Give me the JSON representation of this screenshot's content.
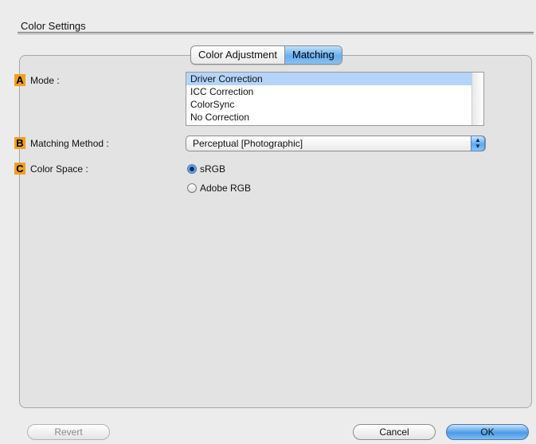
{
  "section_title": "Color Settings",
  "tabs": [
    {
      "label": "Color Adjustment",
      "active": false
    },
    {
      "label": "Matching",
      "active": true
    }
  ],
  "fields": {
    "mode": {
      "badge": "A",
      "label": "Mode :"
    },
    "matching_method": {
      "badge": "B",
      "label": "Matching Method :"
    },
    "color_space": {
      "badge": "C",
      "label": "Color Space :"
    }
  },
  "mode_list": {
    "items": [
      "Driver Correction",
      "ICC Correction",
      "ColorSync",
      "No Correction"
    ],
    "selected": "Driver Correction"
  },
  "matching_method_select": {
    "value": "Perceptual [Photographic]"
  },
  "color_space_options": [
    {
      "label": "sRGB",
      "checked": true
    },
    {
      "label": "Adobe RGB",
      "checked": false
    }
  ],
  "buttons": {
    "revert": "Revert",
    "cancel": "Cancel",
    "ok": "OK"
  },
  "colors": {
    "badge": "#f0a020",
    "selection": "#b5d4fa",
    "aqua_blue": "#4b9be8"
  }
}
